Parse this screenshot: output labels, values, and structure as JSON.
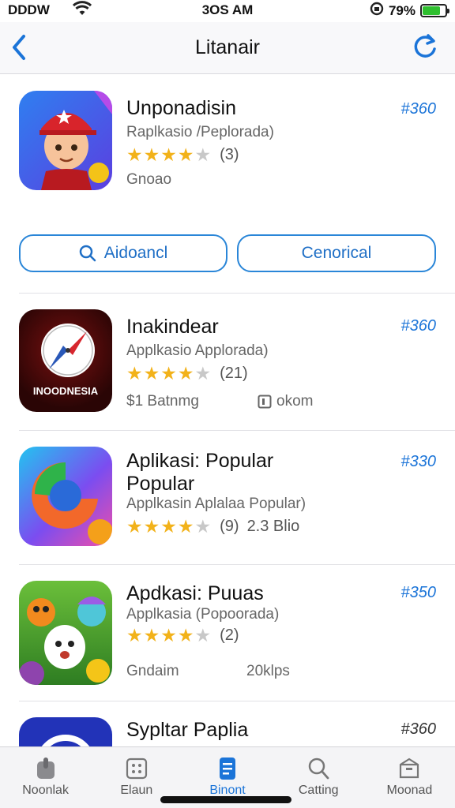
{
  "status_bar": {
    "carrier": "DDDW",
    "time": "3OS AM",
    "battery_percent": "79%",
    "battery_level": 0.79,
    "icons": [
      "wifi-icon",
      "rotation-lock-icon",
      "battery-icon"
    ]
  },
  "nav": {
    "title": "Litanair",
    "back_icon": "chevron-left-icon",
    "refresh_icon": "refresh-icon"
  },
  "apps": [
    {
      "name": "Unponadisin",
      "subtitle": "Raplkasio /Peplorada)",
      "stars": 4.5,
      "rating_count": "(3)",
      "meta": "Gnoao",
      "price": "#360",
      "icon": "cartoon-boy-icon"
    },
    {
      "name": "Inakindear",
      "subtitle": "Applkasio Applorada)",
      "stars": 4.0,
      "rating_count": "(21)",
      "meta": "$1 Batnmg",
      "meta2": "okom",
      "icon_text": "INOODNESIA",
      "price": "#360",
      "icon": "compass-icon"
    },
    {
      "name_line1": "Aplikasi: Popular",
      "name_line2": "Popular",
      "subtitle": "Applkasin Aplalaa Popular)",
      "stars": 4.5,
      "rating_count": "(9)",
      "size": "2.3 Blio",
      "price": "#330",
      "icon": "colorful-swirl-icon"
    },
    {
      "name": "Apdkasi: Puuas",
      "subtitle": "Applkasia (Popoorada)",
      "stars": 4.5,
      "rating_count": "(2)",
      "meta": "Gndaim",
      "meta2": "20klps",
      "price": "#350",
      "icon": "cartoon-characters-icon"
    },
    {
      "name": "Sypltar Paplia",
      "price": "#360",
      "icon": "blue-circle-icon"
    }
  ],
  "buttons": {
    "search_label": "Aidoancl",
    "secondary_label": "Cenorical"
  },
  "tabs": [
    {
      "label": "Noonlak",
      "icon": "games-icon"
    },
    {
      "label": "Elaun",
      "icon": "apps-grid-icon"
    },
    {
      "label": "Binont",
      "icon": "today-icon",
      "active": true
    },
    {
      "label": "Catting",
      "icon": "search-icon"
    },
    {
      "label": "Moonad",
      "icon": "box-icon"
    }
  ],
  "colors": {
    "accent": "#1b74d8",
    "star": "#f2b21a",
    "battery": "#2fbf2f"
  }
}
